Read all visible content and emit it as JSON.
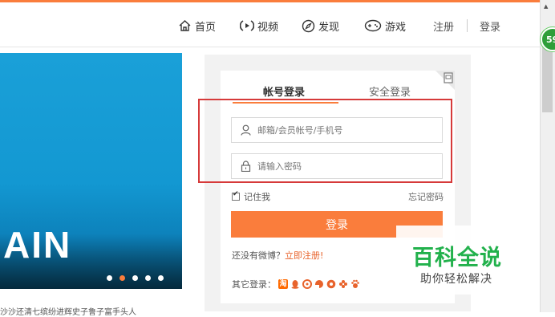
{
  "nav": {
    "home": "首页",
    "video": "视频",
    "discover": "发现",
    "games": "游戏",
    "register": "注册",
    "login": "登录"
  },
  "badge_count": "59",
  "banner": {
    "text": "AIN",
    "bottom_text": "沙沙还清七缤纷进辉史子鲁子富手头人"
  },
  "login": {
    "tab_account": "帐号登录",
    "tab_safe": "安全登录",
    "username_placeholder": "邮箱/会员帐号/手机号",
    "password_placeholder": "请输入密码",
    "remember_me": "记住我",
    "forgot_password": "忘记密码",
    "submit": "登录",
    "no_account": "还没有微博？",
    "register_now": "立即注册!",
    "other_login": "其它登录："
  },
  "watermark": {
    "title": "百科全说",
    "subtitle": "助你轻松解决"
  },
  "colors": {
    "accent": "#fa7d3c",
    "highlight_box": "#d63a3a",
    "watermark_green": "#22b14c"
  }
}
